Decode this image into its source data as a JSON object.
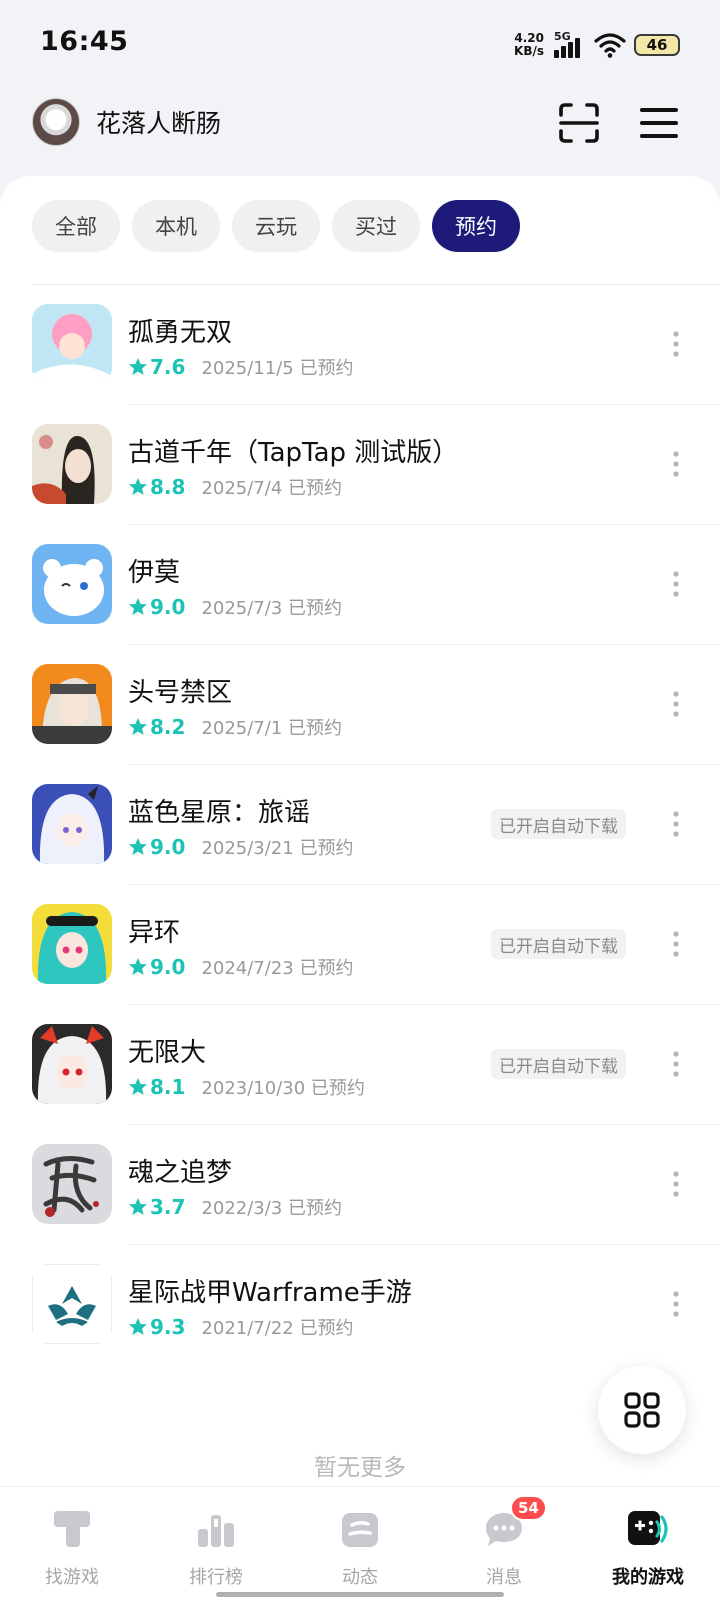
{
  "status_bar": {
    "time": "16:45",
    "net_speed_value": "4.20",
    "net_speed_unit": "KB/s",
    "network": "5G",
    "battery": "46"
  },
  "header": {
    "username": "花落人断肠"
  },
  "filters": [
    {
      "label": "全部",
      "active": false
    },
    {
      "label": "本机",
      "active": false
    },
    {
      "label": "云玩",
      "active": false
    },
    {
      "label": "买过",
      "active": false
    },
    {
      "label": "预约",
      "active": true
    }
  ],
  "games": [
    {
      "title": "孤勇无双",
      "score": "7.6",
      "date": "2025/11/5 已预约",
      "auto_download": ""
    },
    {
      "title": "古道千年（TapTap 测试版）",
      "score": "8.8",
      "date": "2025/7/4 已预约",
      "auto_download": ""
    },
    {
      "title": "伊莫",
      "score": "9.0",
      "date": "2025/7/3 已预约",
      "auto_download": ""
    },
    {
      "title": "头号禁区",
      "score": "8.2",
      "date": "2025/7/1 已预约",
      "auto_download": ""
    },
    {
      "title": "蓝色星原：旅谣",
      "score": "9.0",
      "date": "2025/3/21 已预约",
      "auto_download": "已开启自动下载"
    },
    {
      "title": "异环",
      "score": "9.0",
      "date": "2024/7/23 已预约",
      "auto_download": "已开启自动下载"
    },
    {
      "title": "无限大",
      "score": "8.1",
      "date": "2023/10/30 已预约",
      "auto_download": "已开启自动下载"
    },
    {
      "title": "魂之追梦",
      "score": "3.7",
      "date": "2022/3/3 已预约",
      "auto_download": ""
    },
    {
      "title": "星际战甲Warframe手游",
      "score": "9.3",
      "date": "2021/7/22 已预约",
      "auto_download": ""
    }
  ],
  "footer_text": "暂无更多",
  "bottom_nav": [
    {
      "label": "找游戏",
      "icon": "find-games-icon",
      "active": false
    },
    {
      "label": "排行榜",
      "icon": "ranking-icon",
      "active": false
    },
    {
      "label": "动态",
      "icon": "feed-icon",
      "active": false
    },
    {
      "label": "消息",
      "icon": "message-icon",
      "active": false,
      "badge": "54"
    },
    {
      "label": "我的游戏",
      "icon": "my-games-icon",
      "active": true
    }
  ],
  "colors": {
    "accent": "#1d1a7a",
    "score": "#1cc3b4",
    "badge": "#ff4d4d"
  }
}
